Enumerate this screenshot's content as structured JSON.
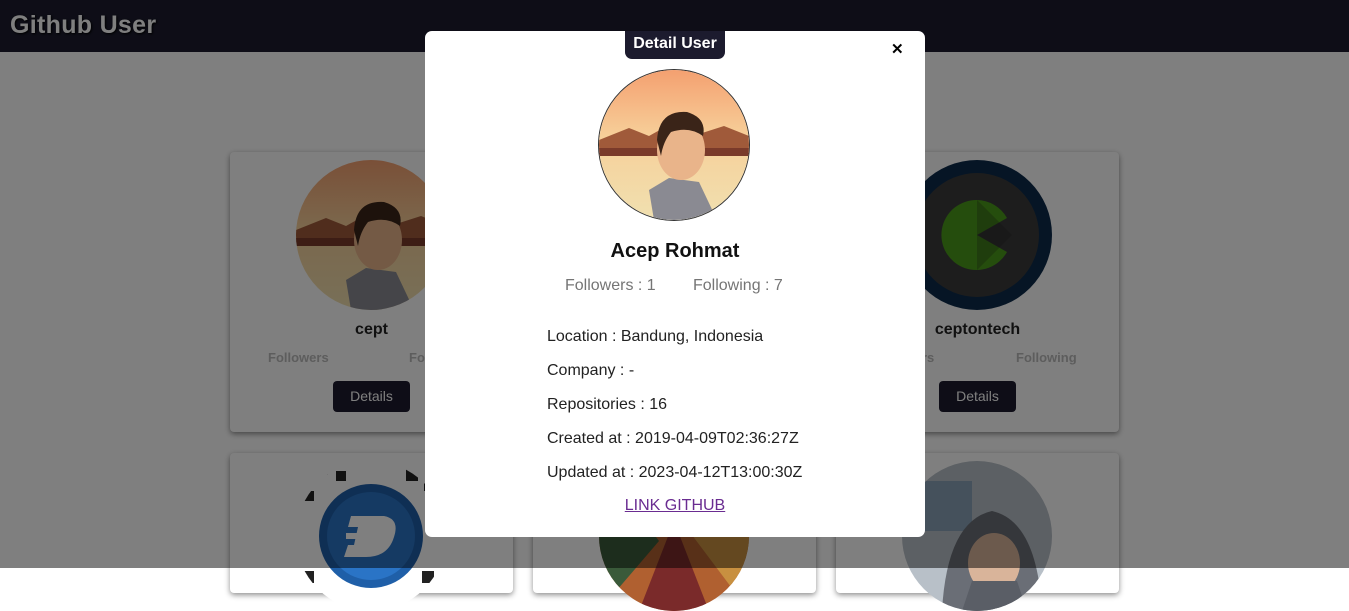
{
  "app": {
    "title": "Github User"
  },
  "cards": [
    {
      "name": "cept",
      "followers_label": "Followers",
      "following_label": "Fo",
      "button": "Details"
    },
    {
      "name": "ceptontech",
      "followers_label": "rs",
      "following_label": "Following",
      "button": "Details"
    }
  ],
  "modal": {
    "tab": "Detail User",
    "close": "✕",
    "name": "Acep Rohmat",
    "followers": "Followers : 1",
    "following": "Following : 7",
    "location": "Location : Bandung, Indonesia",
    "company": "Company : -",
    "repositories": "Repositories : 16",
    "created_at": "Created at : 2019-04-09T02:36:27Z",
    "updated_at": "Updated at : 2023-04-12T13:00:30Z",
    "link": "LINK GITHUB"
  },
  "colors": {
    "navbar": "#1c1b2e",
    "link": "#6a2c91",
    "button": "#1c1b2e"
  },
  "icons": {
    "close": "close-icon"
  }
}
